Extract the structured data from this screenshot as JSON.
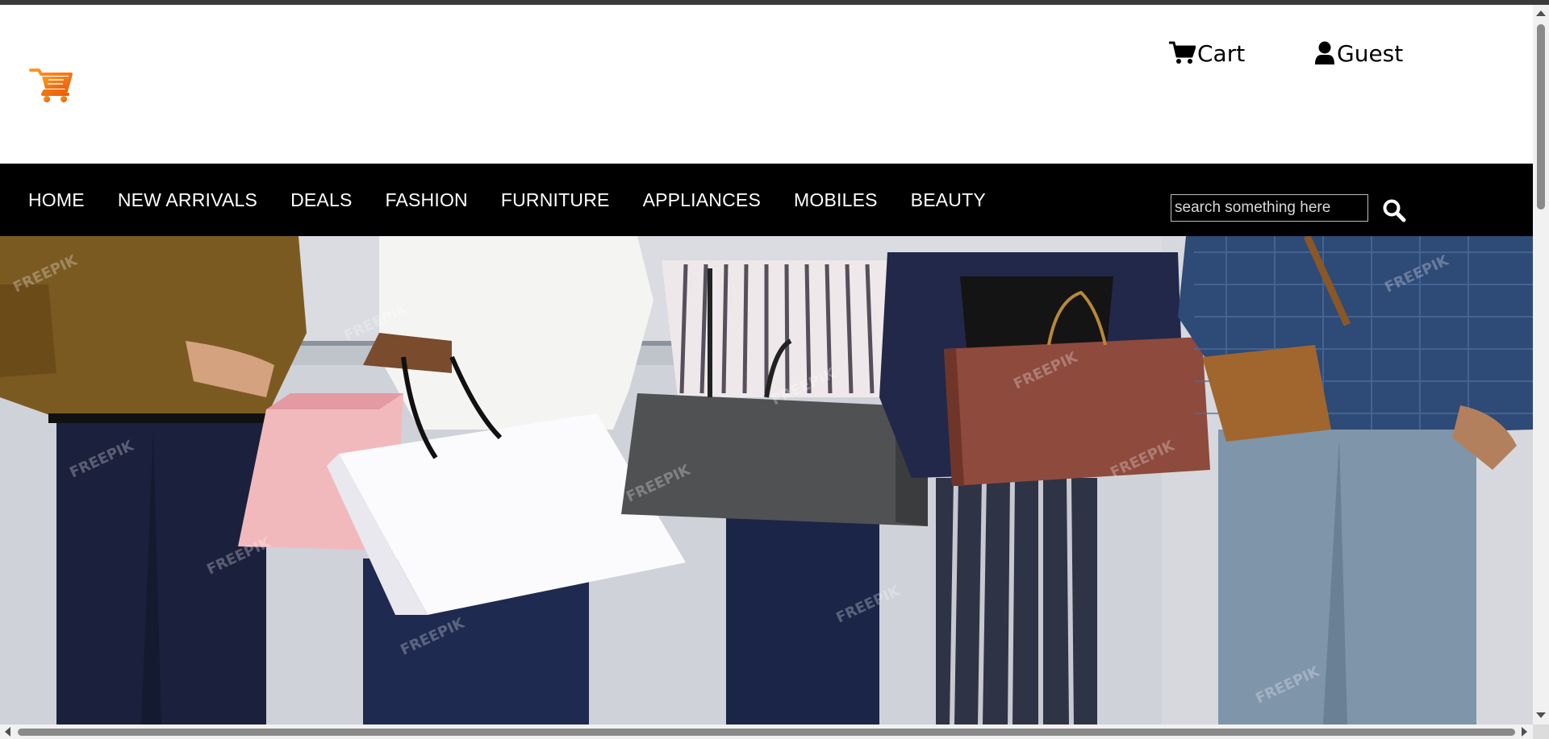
{
  "header": {
    "cart_label": "Cart",
    "guest_label": "Guest",
    "logo_icon": "shopping-cart-logo-icon",
    "accent_color": "#f47b20"
  },
  "nav": {
    "items": [
      {
        "label": "HOME"
      },
      {
        "label": "NEW ARRIVALS"
      },
      {
        "label": "DEALS"
      },
      {
        "label": "FASHION"
      },
      {
        "label": "FURNITURE"
      },
      {
        "label": "APPLIANCES"
      },
      {
        "label": "MOBILES"
      },
      {
        "label": "BEAUTY"
      }
    ]
  },
  "search": {
    "placeholder": "search something here",
    "icon": "search-icon"
  },
  "hero": {
    "image_alt": "Five people holding shopping bags",
    "watermark": "FREEPIK"
  }
}
